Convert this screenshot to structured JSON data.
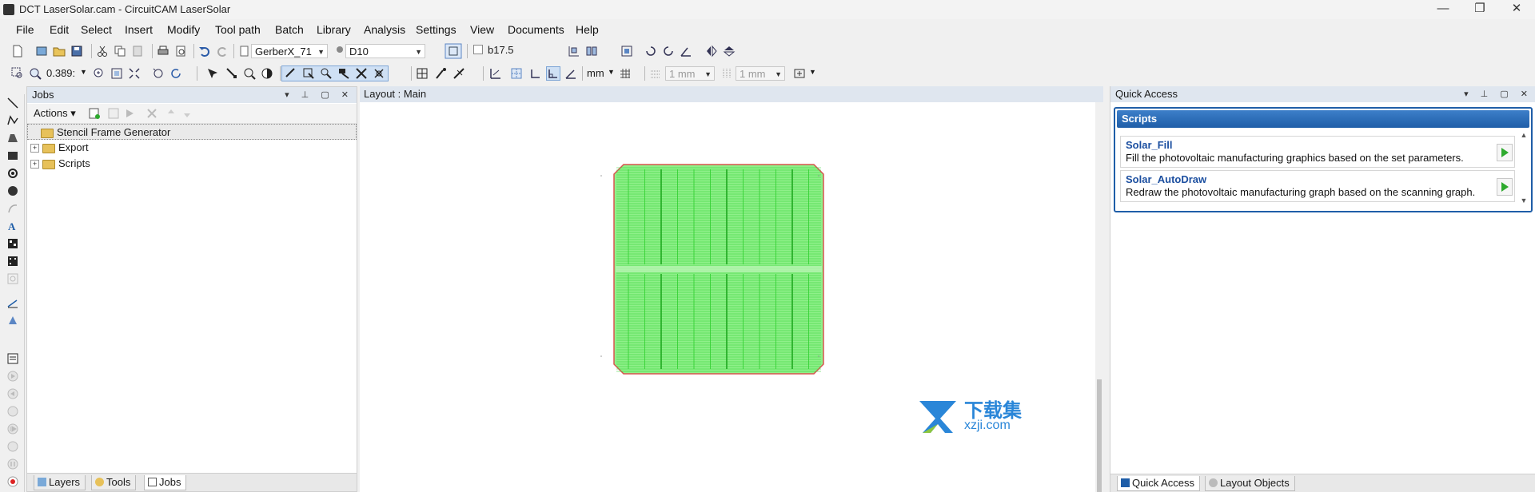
{
  "window": {
    "title": "DCT LaserSolar.cam - CircuitCAM LaserSolar",
    "minimize": "—",
    "restore": "❐",
    "close": "✕"
  },
  "menu": {
    "items": [
      "File",
      "Edit",
      "Select",
      "Insert",
      "Modify",
      "Tool path",
      "Batch",
      "Library",
      "Analysis",
      "Settings",
      "View",
      "Documents",
      "Help"
    ]
  },
  "toolbar1": {
    "aperture_name": "GerberX_71",
    "tool_name": "D10",
    "layer_field": "b17.5"
  },
  "toolbar2": {
    "zoom_value": "0.389:",
    "unit": "mm",
    "grid_x": "1 mm",
    "grid_y": "1 mm"
  },
  "jobs": {
    "title": "Jobs",
    "actions_label": "Actions",
    "tree": [
      {
        "label": "Stencil Frame Generator",
        "expandable": false
      },
      {
        "label": "Export",
        "expandable": true
      },
      {
        "label": "Scripts",
        "expandable": true
      }
    ],
    "tabs": [
      "Layers",
      "Tools",
      "Jobs"
    ]
  },
  "layout": {
    "title": "Layout : Main"
  },
  "quick_access": {
    "title": "Quick Access",
    "group_title": "Scripts",
    "items": [
      {
        "name": "Solar_Fill",
        "description": "Fill the photovoltaic manufacturing graphics based on the set parameters."
      },
      {
        "name": "Solar_AutoDraw",
        "description": "Redraw the photovoltaic manufacturing graph based on the scanning graph."
      }
    ],
    "tabs": [
      "Quick Access",
      "Layout Objects"
    ]
  },
  "watermark": {
    "cn_text": "下载集",
    "site": "xzji.com"
  },
  "colors": {
    "cell_fill": "#8ff08a",
    "cell_line": "#2ecf2e",
    "cell_edge": "#d9534f",
    "accent": "#1f5ea8",
    "watermark_blue": "#2a86d8"
  }
}
